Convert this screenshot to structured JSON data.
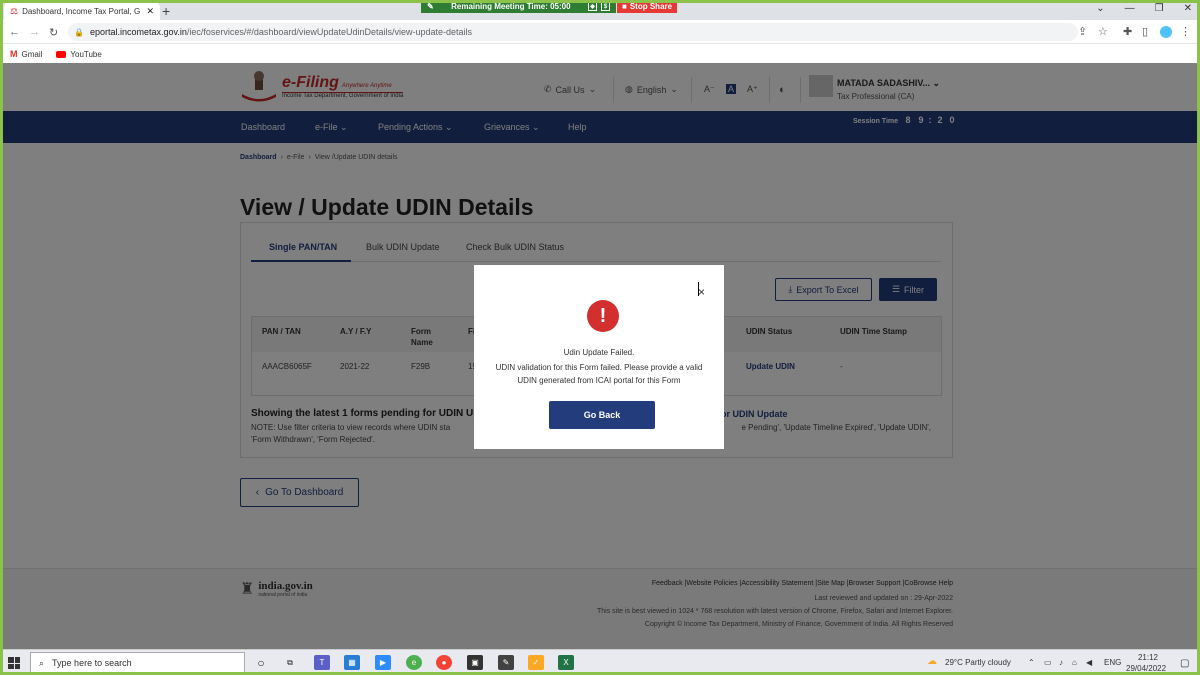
{
  "browser": {
    "tab_title": "Dashboard, Income Tax Portal, G",
    "new_tab": "+",
    "meeting_timer": "Remaining Meeting Time: 05:00",
    "stop_share": "Stop Share",
    "url_host": "eportal.incometax.gov.in",
    "url_path": "/iec/foservices/#/dashboard/viewUpdateUdinDetails/view-update-details",
    "bookmarks": [
      "Gmail",
      "YouTube"
    ]
  },
  "header": {
    "logo_title": "e-Filing",
    "logo_tagline": "Anywhere Anytime",
    "logo_sub": "Income Tax Department, Government of India",
    "call_us": "Call Us",
    "language": "English",
    "font_small": "A⁻",
    "font_normal": "A",
    "font_large": "A⁺",
    "user_name": "MATADA SADASHIV...",
    "user_role": "Tax Professional (CA)"
  },
  "menu": {
    "items": [
      "Dashboard",
      "e-File",
      "Pending Actions",
      "Grievances",
      "Help"
    ],
    "session_label": "Session Time",
    "session_digits": [
      "8",
      "9",
      ":",
      "2",
      "0"
    ]
  },
  "breadcrumb": {
    "home": "Dashboard",
    "efile": "e-File",
    "current": "View /Update UDIN details"
  },
  "page_title": "View / Update UDIN Details",
  "tabs": [
    "Single PAN/TAN",
    "Bulk UDIN Update",
    "Check Bulk UDIN Status"
  ],
  "actions": {
    "export": "Export To Excel",
    "filter": "Filter"
  },
  "table": {
    "headers": [
      "PAN / TAN",
      "A.Y / F.Y",
      "Form Name",
      "Fi",
      "UDIN Status",
      "UDIN Time Stamp"
    ],
    "row": {
      "pan": "AAACB6065F",
      "ay": "2021-22",
      "form": "F29B",
      "fi": "1!",
      "status": "Update UDIN",
      "timestamp": "-"
    }
  },
  "showing_text": "Showing the latest 1 forms pending for UDIN Up",
  "showing_link": "or UDIN Update",
  "note_line1": "NOTE: Use filter criteria to view records where UDIN sta",
  "note_line1_end": "e Pending', 'Update Timeline Expired', 'Update UDIN',",
  "note_line2": "'Form Withdrawn', 'Form Rejected'.",
  "go_dashboard": "Go To Dashboard",
  "footer": {
    "india_title": "india.gov.in",
    "india_sub": "national portal of india",
    "links": "Feedback |Website Policies |Accessibility Statement |Site Map |Browser Support |CoBrowse Help",
    "reviewed": "Last reviewed and updated on : 29-Apr-2022",
    "best_viewed": "This site is best viewed in 1024 * 768 resolution with latest version of Chrome, Firefox, Safari and Internet Explorer.",
    "copyright": "Copyright © Income Tax Department, Ministry of Finance, Government of India. All Rights Reserved"
  },
  "modal": {
    "close": "×",
    "icon": "!",
    "title": "Udin Update Failed.",
    "body": "UDIN validation for this Form failed. Please provide a valid UDIN generated from ICAI portal for this Form",
    "button": "Go Back"
  },
  "taskbar": {
    "search_placeholder": "Type here to search",
    "weather": "29°C  Partly cloudy",
    "lang": "ENG",
    "time": "21:12",
    "date": "29/04/2022"
  }
}
